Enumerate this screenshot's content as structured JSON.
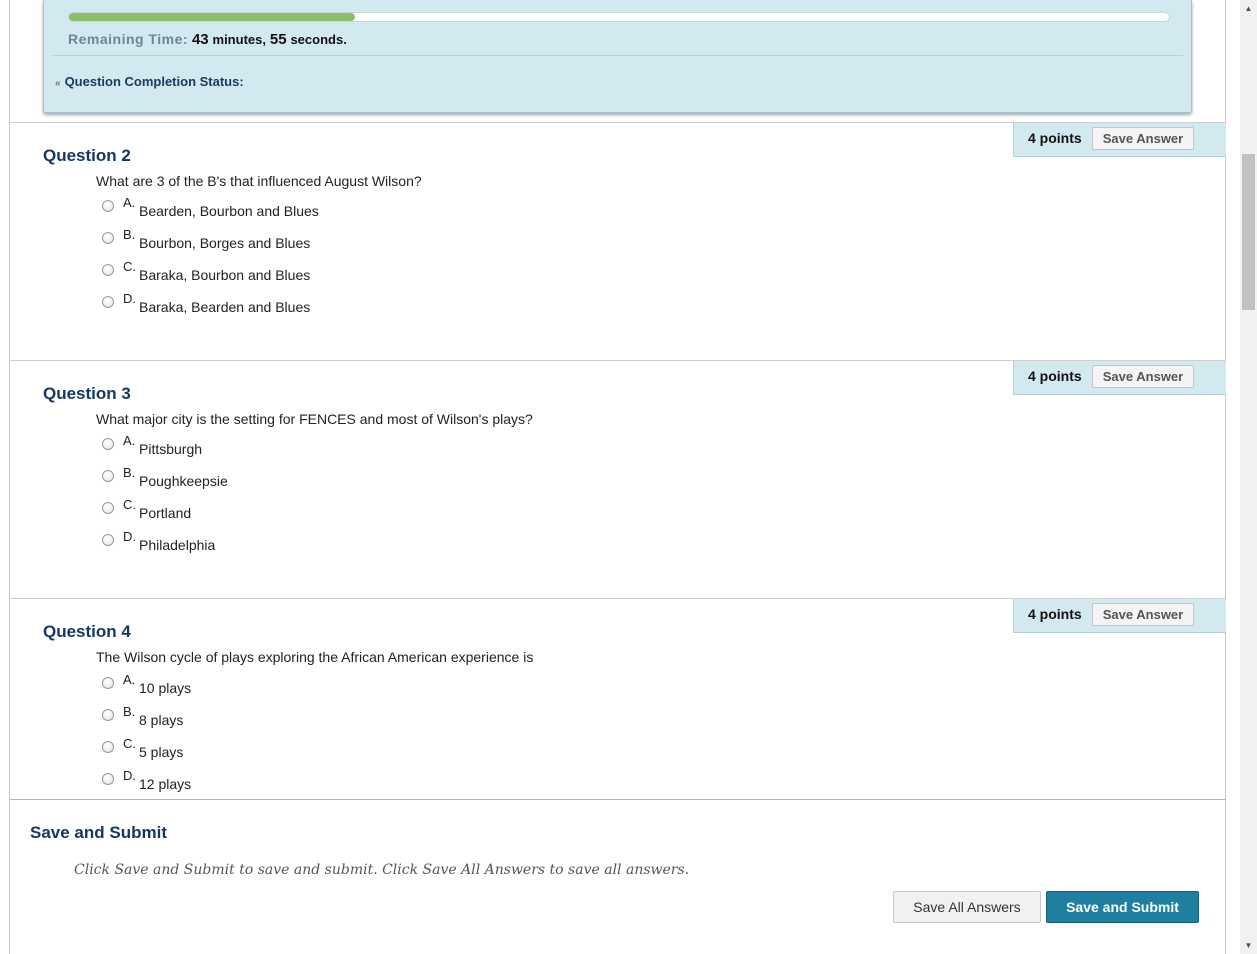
{
  "timer": {
    "progress_percent": 26,
    "remaining_label": "Remaining Time:",
    "minutes_value": "43",
    "minutes_unit": "minutes,",
    "seconds_value": "55",
    "seconds_unit": "seconds.",
    "completion_label": "Question Completion Status:"
  },
  "questions": [
    {
      "title": "Question 2",
      "text": "What are 3 of the B's that influenced August Wilson?",
      "points": "4 points",
      "save_label": "Save Answer",
      "options": [
        {
          "letter": "A.",
          "text": "Bearden, Bourbon and Blues"
        },
        {
          "letter": "B.",
          "text": "Bourbon, Borges and Blues"
        },
        {
          "letter": "C.",
          "text": "Baraka, Bourbon and Blues"
        },
        {
          "letter": "D.",
          "text": "Baraka, Bearden and Blues"
        }
      ]
    },
    {
      "title": "Question 3",
      "text": "What major city is the setting for FENCES and most of Wilson's plays?",
      "points": "4 points",
      "save_label": "Save Answer",
      "options": [
        {
          "letter": "A.",
          "text": "Pittsburgh"
        },
        {
          "letter": "B.",
          "text": "Poughkeepsie"
        },
        {
          "letter": "C.",
          "text": "Portland"
        },
        {
          "letter": "D.",
          "text": "Philadelphia"
        }
      ]
    },
    {
      "title": "Question 4",
      "text": "The Wilson cycle of plays exploring the African American experience is",
      "points": "4 points",
      "save_label": "Save Answer",
      "options": [
        {
          "letter": "A.",
          "text": "10 plays"
        },
        {
          "letter": "B.",
          "text": "8 plays"
        },
        {
          "letter": "C.",
          "text": "5 plays"
        },
        {
          "letter": "D.",
          "text": "12 plays"
        }
      ]
    }
  ],
  "submit": {
    "title": "Save and Submit",
    "instructions": "Click Save and Submit to save and submit. Click Save All Answers to save all answers.",
    "save_all_label": "Save All Answers",
    "save_submit_label": "Save and Submit"
  },
  "colors": {
    "panel_bg": "#d3e9f0",
    "progress_fill": "#8cc068",
    "title_blue": "#15365f",
    "submit_button": "#1f7fa1"
  }
}
